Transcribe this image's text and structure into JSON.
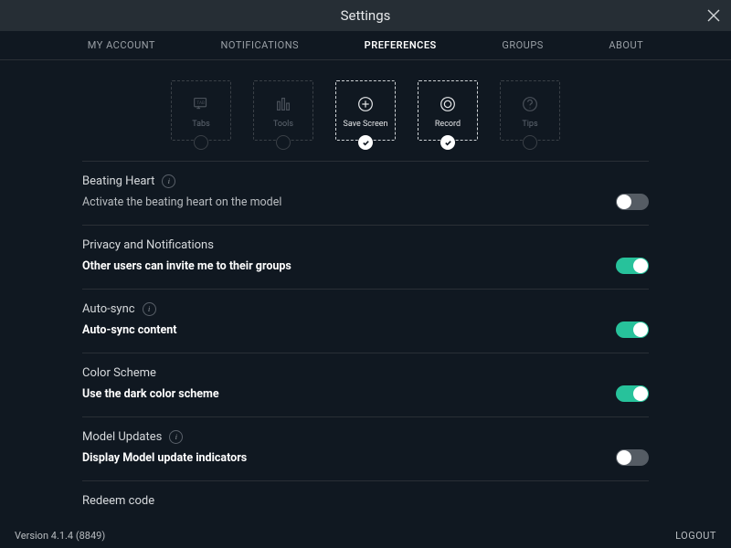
{
  "window": {
    "title": "Settings"
  },
  "tabs": [
    {
      "label": "MY ACCOUNT",
      "active": false
    },
    {
      "label": "NOTIFICATIONS",
      "active": false
    },
    {
      "label": "PREFERENCES",
      "active": true
    },
    {
      "label": "GROUPS",
      "active": false
    },
    {
      "label": "ABOUT",
      "active": false
    }
  ],
  "tiles": [
    {
      "label": "Tabs",
      "active": false,
      "icon": "tabs-icon"
    },
    {
      "label": "Tools",
      "active": false,
      "icon": "tools-icon"
    },
    {
      "label": "Save Screen",
      "active": true,
      "icon": "plus-circle-icon"
    },
    {
      "label": "Record",
      "active": true,
      "icon": "record-icon"
    },
    {
      "label": "Tips",
      "active": false,
      "icon": "question-icon"
    }
  ],
  "sections": {
    "beating_heart": {
      "heading": "Beating Heart",
      "desc": "Activate the beating heart on the model",
      "info": true,
      "bold": false,
      "on": false
    },
    "privacy": {
      "heading": "Privacy and Notifications",
      "desc": "Other users can invite me to their groups",
      "info": false,
      "bold": true,
      "on": true
    },
    "autosync": {
      "heading": "Auto-sync",
      "desc": "Auto-sync content",
      "info": true,
      "bold": true,
      "on": true
    },
    "colorscheme": {
      "heading": "Color Scheme",
      "desc": "Use the dark color scheme",
      "info": false,
      "bold": true,
      "on": true
    },
    "updates": {
      "heading": "Model Updates",
      "desc": "Display Model update indicators",
      "info": true,
      "bold": true,
      "on": false
    }
  },
  "redeem": {
    "label": "Redeem code"
  },
  "footer": {
    "version": "Version 4.1.4 (8849)",
    "logout": "LOGOUT"
  },
  "info_char": "i"
}
